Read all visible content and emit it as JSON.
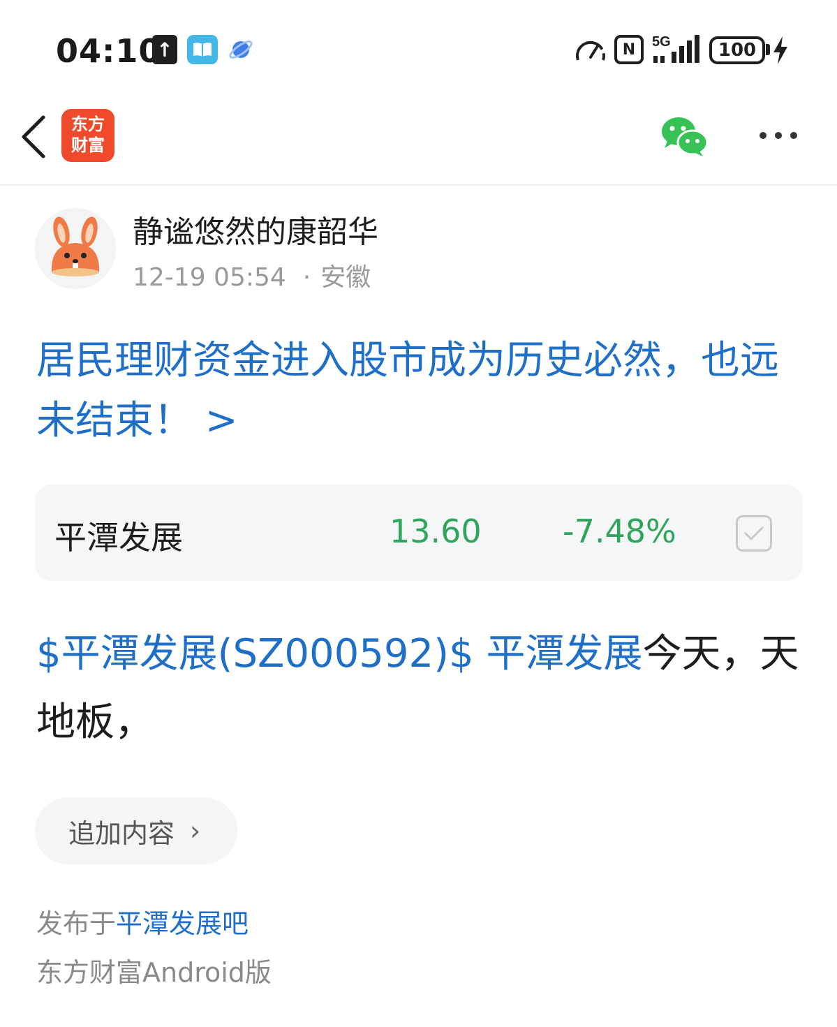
{
  "status_bar": {
    "time": "04:10",
    "upload_glyph": "↑",
    "book_glyph": "📖",
    "nfc_label": "N",
    "network_label": "5G",
    "battery_level": "100"
  },
  "nav": {
    "logo_line1": "东方",
    "logo_line2": "财富",
    "more_icon": "more-dots-icon",
    "share_icon": "wechat-icon"
  },
  "author": {
    "name": "静谧悠然的康韶华",
    "date": "12-19 05:54",
    "separator": "·",
    "location": "安徽"
  },
  "post": {
    "title": "居民理财资金进入股市成为历史必然，也远未结束！ >",
    "body_link": "$平潭发展(SZ000592)$ 平潭发展",
    "body_text": "今天，天地板，"
  },
  "stock": {
    "name": "平潭发展",
    "price": "13.60",
    "change": "-7.48%",
    "change_color": "#2ea55a"
  },
  "append": {
    "label": "追加内容",
    "chevron": "›"
  },
  "footer": {
    "published_prefix": "发布于",
    "forum_link": "平潭发展吧",
    "client": "东方财富Android版"
  }
}
